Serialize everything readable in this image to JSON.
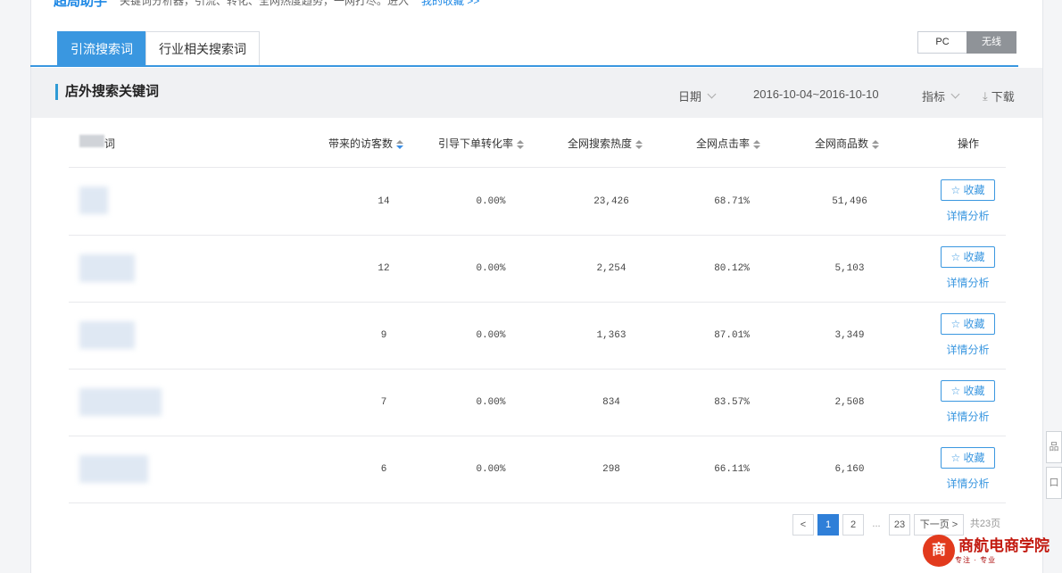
{
  "header": {
    "brand": "超局助手",
    "tagline": "关键词分析器，引流、转化、全网热度趋势，一网打尽。进入",
    "link_text": "我的收藏 >>"
  },
  "tabs": [
    {
      "label": "引流搜索词",
      "active": true
    },
    {
      "label": "行业相关搜索词",
      "active": false
    }
  ],
  "device_toggle": {
    "pc": "PC",
    "mobile": "无线",
    "selected": "无线"
  },
  "section": {
    "title": "店外搜索关键词",
    "date_label": "日期",
    "date_range": "2016-10-04~2016-10-10",
    "metrics_label": "指标",
    "download_label": "下载"
  },
  "table": {
    "columns": [
      "词",
      "带来的访客数",
      "引导下单转化率",
      "全网搜索热度",
      "全网点击率",
      "全网商品数",
      "操作"
    ],
    "rows": [
      {
        "visitors": "14",
        "conversion": "0.00%",
        "search_heat": "23,426",
        "ctr": "68.71%",
        "products": "51,496"
      },
      {
        "visitors": "12",
        "conversion": "0.00%",
        "search_heat": "2,254",
        "ctr": "80.12%",
        "products": "5,103"
      },
      {
        "visitors": "9",
        "conversion": "0.00%",
        "search_heat": "1,363",
        "ctr": "87.01%",
        "products": "3,349"
      },
      {
        "visitors": "7",
        "conversion": "0.00%",
        "search_heat": "834",
        "ctr": "83.57%",
        "products": "2,508"
      },
      {
        "visitors": "6",
        "conversion": "0.00%",
        "search_heat": "298",
        "ctr": "66.11%",
        "products": "6,160"
      }
    ],
    "favorite_label": "☆ 收藏",
    "detail_label": "详情分析"
  },
  "pagination": {
    "prev": "<",
    "pages": [
      "1",
      "2",
      "...",
      "23"
    ],
    "current": "1",
    "next": "下一页 >",
    "total": "共23页"
  },
  "side_tools": [
    "品",
    "口"
  ],
  "watermark": {
    "logo_char": "商",
    "text": "商航电商学院",
    "sub": "专注 · 专业"
  },
  "colors": {
    "accent": "#3a97e0",
    "page_active": "#2f7fd8",
    "section_bg": "#f0f1f3"
  }
}
